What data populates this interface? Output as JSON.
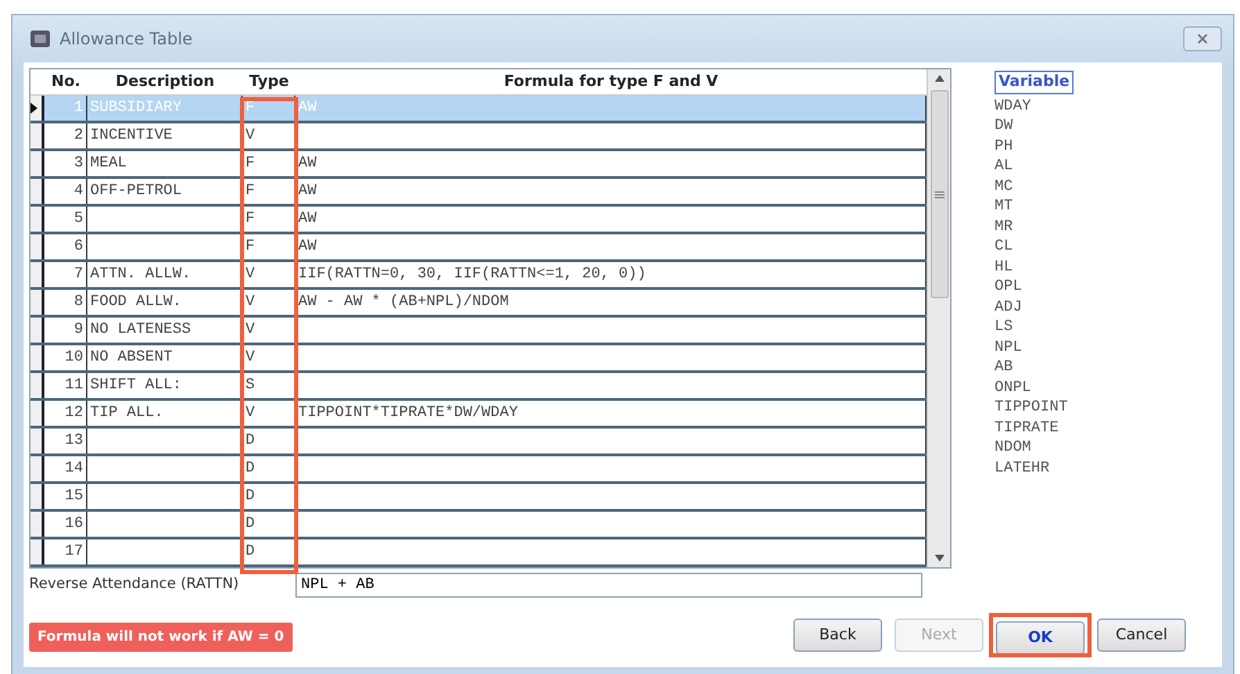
{
  "window": {
    "title": "Allowance Table"
  },
  "table": {
    "columns": [
      {
        "label": "No.",
        "annotated": false
      },
      {
        "label": "Description",
        "annotated": false
      },
      {
        "label": "Type",
        "annotated": true
      },
      {
        "label": "Formula for type F and V",
        "annotated": false
      }
    ],
    "rows": [
      {
        "no": "1",
        "description": "SUBSIDIARY",
        "type": "F",
        "formula": "AW",
        "selected": true
      },
      {
        "no": "2",
        "description": "INCENTIVE",
        "type": "V",
        "formula": "",
        "selected": false
      },
      {
        "no": "3",
        "description": "MEAL",
        "type": "F",
        "formula": "AW",
        "selected": false
      },
      {
        "no": "4",
        "description": "OFF-PETROL",
        "type": "F",
        "formula": "AW",
        "selected": false
      },
      {
        "no": "5",
        "description": "",
        "type": "F",
        "formula": "AW",
        "selected": false
      },
      {
        "no": "6",
        "description": "",
        "type": "F",
        "formula": "AW",
        "selected": false
      },
      {
        "no": "7",
        "description": "ATTN. ALLW.",
        "type": "V",
        "formula": "IIF(RATTN=0, 30, IIF(RATTN<=1, 20, 0))",
        "selected": false
      },
      {
        "no": "8",
        "description": "FOOD ALLW.",
        "type": "V",
        "formula": "AW - AW * (AB+NPL)/NDOM",
        "selected": false
      },
      {
        "no": "9",
        "description": "NO LATENESS",
        "type": "V",
        "formula": "",
        "selected": false
      },
      {
        "no": "10",
        "description": "NO ABSENT",
        "type": "V",
        "formula": "",
        "selected": false
      },
      {
        "no": "11",
        "description": "SHIFT ALL:",
        "type": "S",
        "formula": "",
        "selected": false
      },
      {
        "no": "12",
        "description": "TIP ALL.",
        "type": "V",
        "formula": "TIPPOINT*TIPRATE*DW/WDAY",
        "selected": false
      },
      {
        "no": "13",
        "description": "",
        "type": "D",
        "formula": "",
        "selected": false
      },
      {
        "no": "14",
        "description": "",
        "type": "D",
        "formula": "",
        "selected": false
      },
      {
        "no": "15",
        "description": "",
        "type": "D",
        "formula": "",
        "selected": false
      },
      {
        "no": "16",
        "description": "",
        "type": "D",
        "formula": "",
        "selected": false
      },
      {
        "no": "17",
        "description": "",
        "type": "D",
        "formula": "",
        "selected": false
      }
    ]
  },
  "variables": {
    "title": "Variable",
    "items": [
      "WDAY",
      "DW",
      "PH",
      "AL",
      "MC",
      "MT",
      "MR",
      "CL",
      "HL",
      "OPL",
      "ADJ",
      "LS",
      "NPL",
      "AB",
      "ONPL",
      "TIPPOINT",
      "TIPRATE",
      "NDOM",
      "LATEHR"
    ]
  },
  "reverse_attendance": {
    "label": "Reverse Attendance (RATTN)",
    "value": "NPL + AB"
  },
  "warning": "Formula will not work if AW = 0",
  "buttons": [
    {
      "label": "Back",
      "disabled": false,
      "annotated": false
    },
    {
      "label": "Next",
      "disabled": true,
      "annotated": false
    },
    {
      "label": "OK",
      "disabled": false,
      "annotated": true
    },
    {
      "label": "Cancel",
      "disabled": false,
      "annotated": false
    }
  ]
}
